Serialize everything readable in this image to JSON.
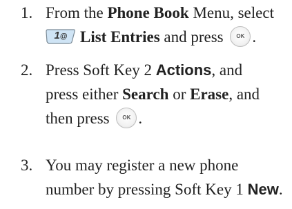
{
  "steps": [
    {
      "number": "1.",
      "text_a": "From the ",
      "bold_a": "Phone Book",
      "text_b": " Menu, select",
      "key_label": "1",
      "key_symbol": "@",
      "bold_b": "List Entries",
      "text_c": " and press",
      "end": "."
    },
    {
      "number": "2.",
      "text_a": "Press Soft Key 2 ",
      "bold_a": "Actions",
      "text_b": ", and",
      "text_c": "press either ",
      "bold_b": "Search",
      "text_d": " or ",
      "bold_c": "Erase",
      "text_e": ", and",
      "text_f": "then press",
      "end": "."
    },
    {
      "number": "3.",
      "text_a": "You may register a new phone",
      "text_b": "number by pressing Soft Key 1 ",
      "bold_a": "New",
      "end": "."
    }
  ],
  "ok_key_label": "OK",
  "colors": {
    "text": "#222222",
    "key_face": "#cfe4f5",
    "key_border": "#7a8a96"
  }
}
